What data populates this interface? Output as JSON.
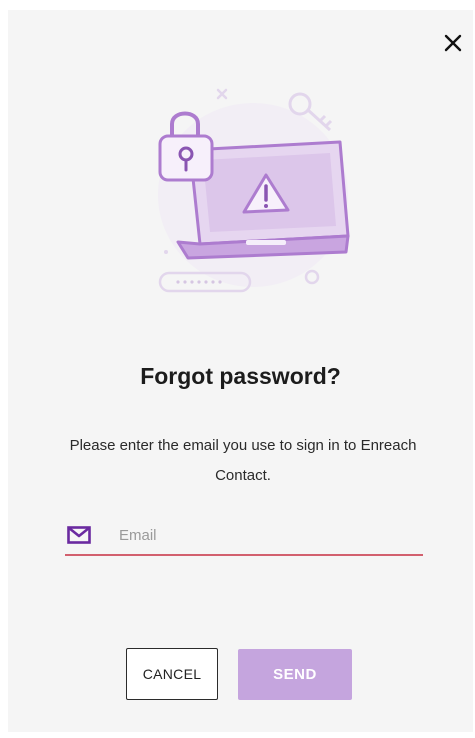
{
  "dialog": {
    "title": "Forgot password?",
    "description": "Please enter the email you use to sign in to Enreach Contact."
  },
  "icons": {
    "close": "close-icon",
    "email": "mail-icon",
    "illustration": "security-illustration"
  },
  "email_field": {
    "value": "",
    "placeholder": "Email"
  },
  "buttons": {
    "cancel": "CANCEL",
    "send": "SEND"
  },
  "colors": {
    "accent": "#9b6bc6",
    "accent_light": "#c5a5de",
    "error_underline": "#d2606e",
    "background": "#f5f5f5"
  }
}
